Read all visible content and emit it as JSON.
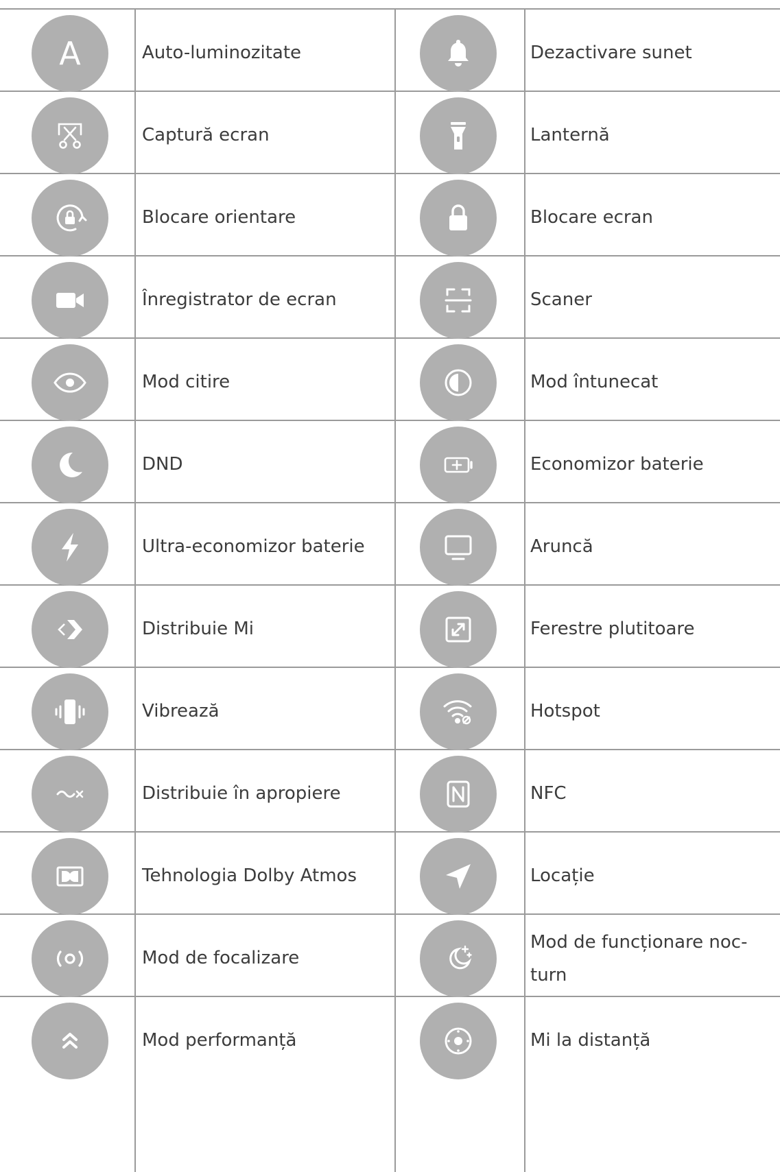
{
  "colors": {
    "icon_bg": "#b0b0b0",
    "icon_fg": "#ffffff",
    "text": "#3c3c3c",
    "rule": "#9a9a9a"
  },
  "rows": [
    {
      "left": {
        "icon": "letter-a-icon",
        "glyph": "A",
        "label": "Auto-luminozitate"
      },
      "right": {
        "icon": "bell-icon",
        "label": "Dezactivare sunet"
      }
    },
    {
      "left": {
        "icon": "screenshot-scissors-icon",
        "label": "Captură ecran"
      },
      "right": {
        "icon": "flashlight-icon",
        "label": "Lanternă"
      }
    },
    {
      "left": {
        "icon": "rotation-lock-icon",
        "label": "Blocare orientare"
      },
      "right": {
        "icon": "padlock-icon",
        "label": "Blocare ecran"
      }
    },
    {
      "left": {
        "icon": "video-camera-icon",
        "label": "Înregistrator de ecran"
      },
      "right": {
        "icon": "scanner-icon",
        "label": "Scaner"
      }
    },
    {
      "left": {
        "icon": "eye-icon",
        "label": "Mod citire"
      },
      "right": {
        "icon": "dark-mode-icon",
        "label": "Mod întunecat"
      }
    },
    {
      "left": {
        "icon": "moon-icon",
        "label": "DND"
      },
      "right": {
        "icon": "battery-saver-icon",
        "label": "Economizor baterie"
      }
    },
    {
      "left": {
        "icon": "lightning-icon",
        "label": "Ultra-economizor baterie"
      },
      "right": {
        "icon": "monitor-cast-icon",
        "label": "Aruncă"
      }
    },
    {
      "left": {
        "icon": "mi-share-icon",
        "label": "Distribuie Mi"
      },
      "right": {
        "icon": "floating-window-icon",
        "label": "Ferestre plutitoare"
      }
    },
    {
      "left": {
        "icon": "vibrate-icon",
        "label": "Vibrează"
      },
      "right": {
        "icon": "hotspot-icon",
        "label": "Hotspot"
      }
    },
    {
      "left": {
        "icon": "nearby-share-icon",
        "label": "Distribuie în apropiere"
      },
      "right": {
        "icon": "nfc-icon",
        "label": "NFC"
      }
    },
    {
      "left": {
        "icon": "dolby-icon",
        "label": "Tehnologia Dolby Atmos"
      },
      "right": {
        "icon": "location-arrow-icon",
        "label": "Locație"
      }
    },
    {
      "left": {
        "icon": "focus-mode-icon",
        "label": "Mod de focalizare"
      },
      "right": {
        "icon": "night-mode-icon",
        "label_line1": "Mod de funcționare noc-",
        "label_line2": "turn"
      }
    },
    {
      "left": {
        "icon": "performance-chevrons-icon",
        "label": "Mod performanță"
      },
      "right": {
        "icon": "remote-icon",
        "label": "Mi la distanță"
      }
    }
  ]
}
